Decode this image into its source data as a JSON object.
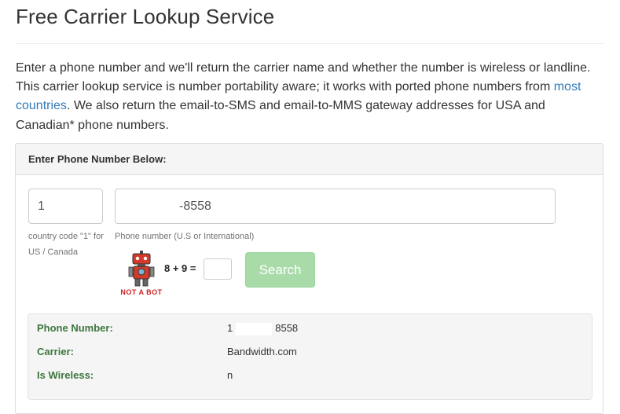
{
  "page": {
    "title": "Free Carrier Lookup Service",
    "intro_before_link": "Enter a phone number and we'll return the carrier name and whether the number is wireless or landline. This carrier lookup service is number portability aware; it works with ported phone numbers from ",
    "intro_link": "most countries",
    "intro_after_link": ". We also return the email-to-SMS and email-to-MMS gateway addresses for USA and Canadian* phone numbers."
  },
  "form": {
    "heading": "Enter Phone Number Below:",
    "country_code_value": "1",
    "country_code_help": "country code \"1\" for US / Canada",
    "phone_value": "-8558",
    "phone_help": "Phone number (U.S or International)",
    "captcha_question": "8 + 9 =",
    "captcha_value": "",
    "robot_text": "NOT A BOT",
    "search_label": "Search"
  },
  "results": {
    "phone_label": "Phone Number:",
    "phone_prefix": "1",
    "phone_suffix": "8558",
    "carrier_label": "Carrier:",
    "carrier_value": "Bandwidth.com",
    "wireless_label": "Is Wireless:",
    "wireless_value": "n"
  },
  "colors": {
    "link": "#337ab7",
    "result_label": "#3c763d",
    "search_button": "#a9dba9",
    "robot": "#cc2222"
  }
}
